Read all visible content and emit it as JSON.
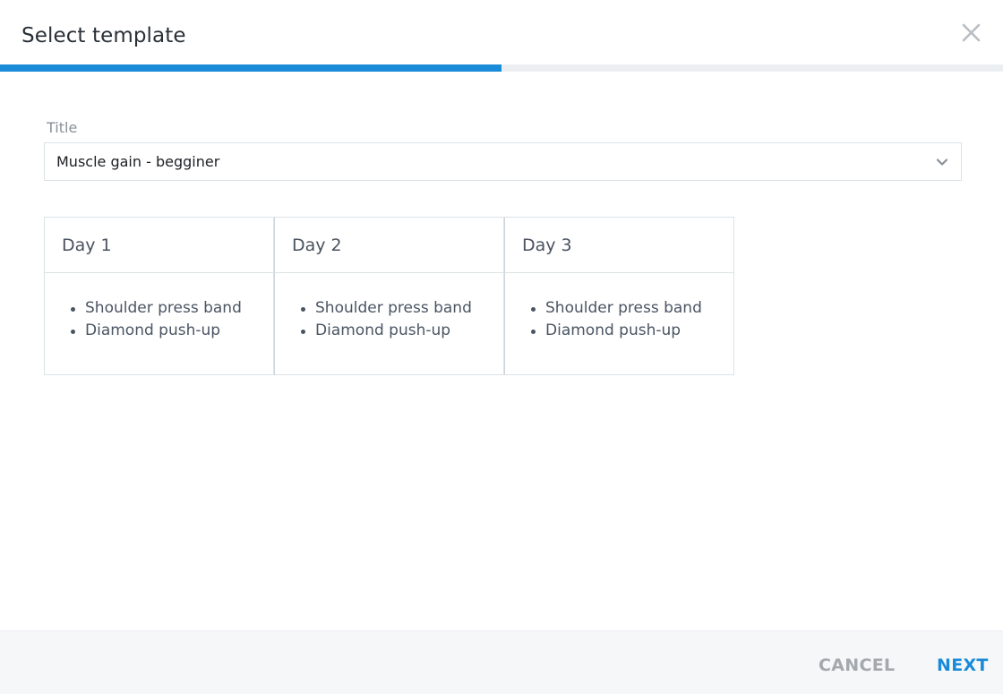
{
  "dialog": {
    "title": "Select template",
    "close_icon": "close-icon",
    "progress_fraction": 0.5,
    "accent_color": "#1a8bd8"
  },
  "form": {
    "title_label": "Title",
    "title_value": "Muscle gain - begginer",
    "dropdown_icon": "chevron-down-icon"
  },
  "days": [
    {
      "title": "Day 1",
      "exercises": [
        "Shoulder press band",
        "Diamond push-up"
      ]
    },
    {
      "title": "Day 2",
      "exercises": [
        "Shoulder press band",
        "Diamond push-up"
      ]
    },
    {
      "title": "Day 3",
      "exercises": [
        "Shoulder press band",
        "Diamond push-up"
      ]
    }
  ],
  "footer": {
    "cancel_label": "CANCEL",
    "next_label": "NEXT"
  }
}
